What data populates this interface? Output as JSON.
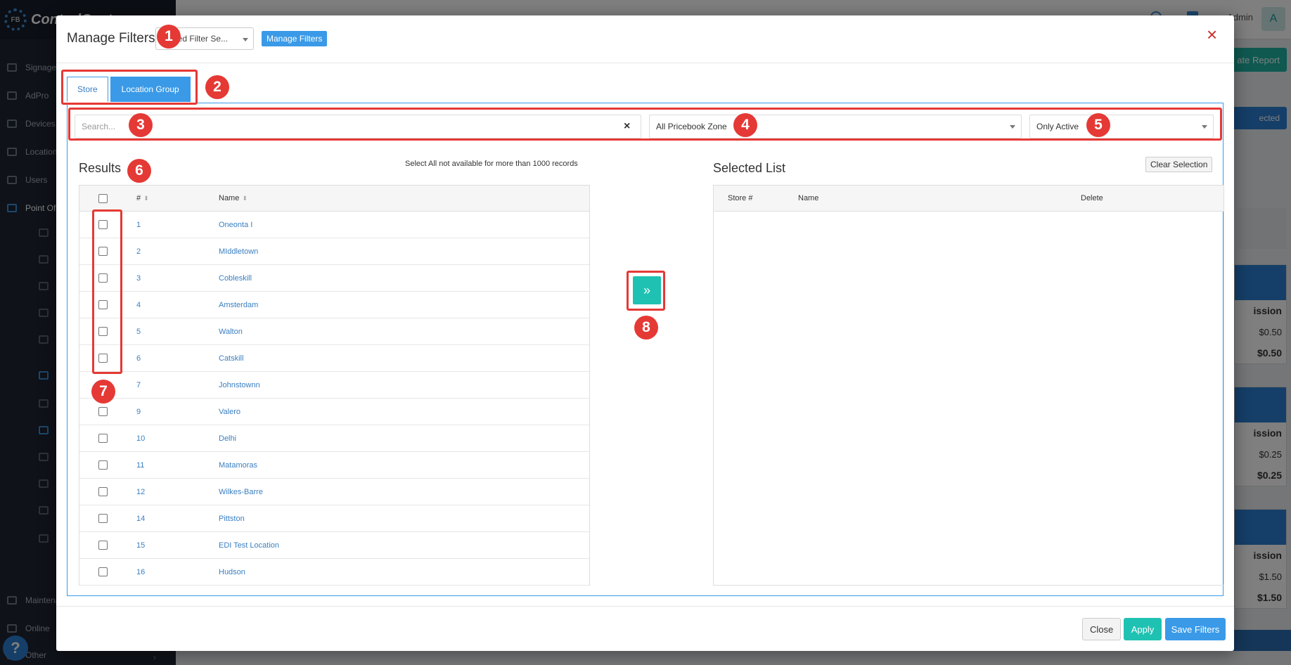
{
  "app": {
    "brand": "ControlCenter",
    "admin_label": "Admin",
    "avatar_letter": "A",
    "sidebar": [
      {
        "label": "Signage",
        "icon": "monitor-icon"
      },
      {
        "label": "AdPro",
        "icon": "pencil-icon"
      },
      {
        "label": "Devices",
        "icon": "devices-icon"
      },
      {
        "label": "Locations",
        "icon": "location-pin-icon"
      },
      {
        "label": "Users",
        "icon": "users-icon"
      },
      {
        "label": "Point Of Sale",
        "icon": "cart-icon"
      },
      {
        "label": "Maintenance",
        "icon": "wrench-icon"
      },
      {
        "label": "Online",
        "icon": "shop-icon"
      },
      {
        "label": "Other",
        "icon": "folder-icon"
      }
    ],
    "help_label": "?",
    "generate_report_label": "ate Report",
    "selected_btn_label": "ected",
    "bg_panels": [
      {
        "header": "ission",
        "row1": "$0.50",
        "row2": "$0.50"
      },
      {
        "header": "ission",
        "row1": "$0.25",
        "row2": "$0.25"
      },
      {
        "header": "ission",
        "row1": "$1.50",
        "row2": "$1.50"
      }
    ]
  },
  "modal": {
    "title": "Manage Filters",
    "saved_filter_value": "Saved Filter Se...",
    "manage_filters_label": "Manage Filters",
    "close_icon": "×",
    "tabs": [
      {
        "label": "Store",
        "active": true
      },
      {
        "label": "Location Group",
        "active": false
      }
    ],
    "search_placeholder": "Search...",
    "clear_icon": "×",
    "pricebook_value": "All Pricebook Zone",
    "status_value": "Only Active",
    "results_title": "Results",
    "select_all_note": "Select All not available for more than 1000 records",
    "results_columns": {
      "num": "#",
      "name": "Name"
    },
    "rows": [
      {
        "num": "1",
        "name": "Oneonta I"
      },
      {
        "num": "2",
        "name": "MIddletown"
      },
      {
        "num": "3",
        "name": "Cobleskill"
      },
      {
        "num": "4",
        "name": "Amsterdam"
      },
      {
        "num": "5",
        "name": "Walton"
      },
      {
        "num": "6",
        "name": "Catskill"
      },
      {
        "num": "7",
        "name": "Johnstownn"
      },
      {
        "num": "9",
        "name": "Valero"
      },
      {
        "num": "10",
        "name": "Delhi"
      },
      {
        "num": "11",
        "name": "Matamoras"
      },
      {
        "num": "12",
        "name": "Wilkes-Barre"
      },
      {
        "num": "14",
        "name": "Pittston"
      },
      {
        "num": "15",
        "name": "EDI Test Location"
      },
      {
        "num": "16",
        "name": "Hudson"
      }
    ],
    "move_icon": "»",
    "selected_title": "Selected List",
    "clear_selection_label": "Clear Selection",
    "selected_columns": {
      "store": "Store #",
      "name": "Name",
      "delete": "Delete"
    },
    "footer": {
      "close": "Close",
      "apply": "Apply",
      "save": "Save Filters"
    }
  },
  "callouts": [
    "1",
    "2",
    "3",
    "4",
    "5",
    "6",
    "7",
    "8"
  ],
  "colors": {
    "primary": "#3a9ae8",
    "teal": "#1fc2b2",
    "callout": "#e53935",
    "link": "#3a7fc1"
  }
}
